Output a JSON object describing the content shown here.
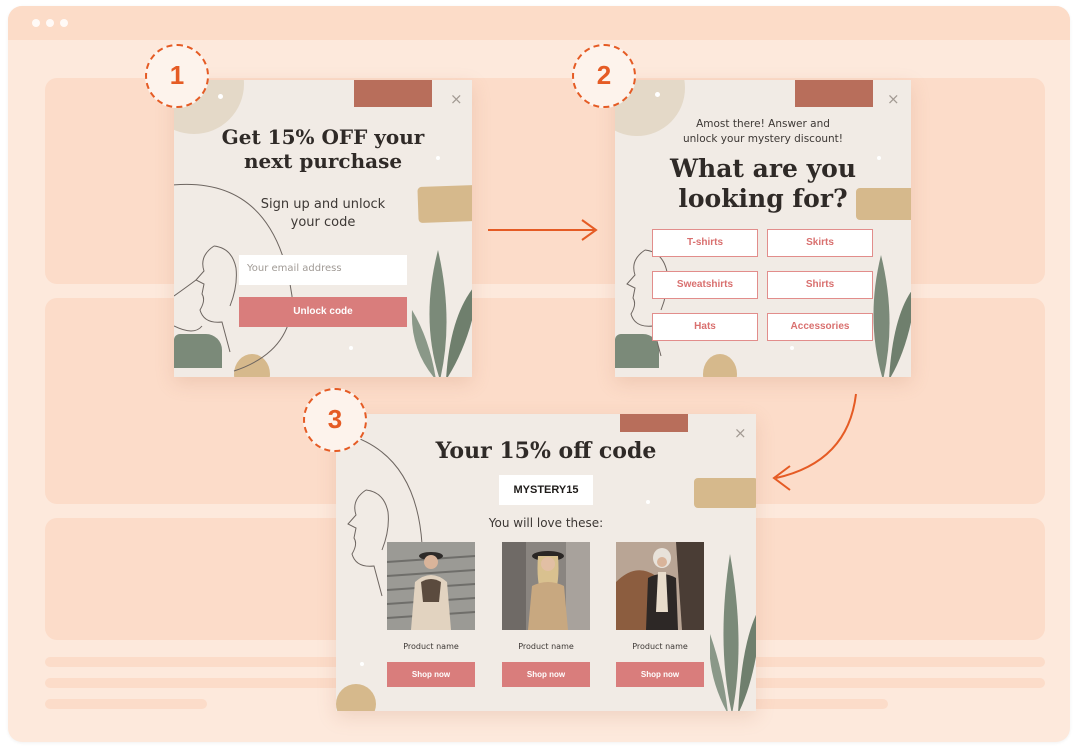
{
  "colors": {
    "accent": "#d97d7c",
    "badge": "#e55b24",
    "bg": "#fde9dc",
    "popup": "#f1ebe5"
  },
  "steps": [
    {
      "number": "1"
    },
    {
      "number": "2"
    },
    {
      "number": "3"
    }
  ],
  "popup1": {
    "title_line1": "Get 15% OFF your",
    "title_line2": "next purchase",
    "sub_line1": "Sign up and unlock",
    "sub_line2": "your code",
    "email_placeholder": "Your email address",
    "button": "Unlock code",
    "close": "×"
  },
  "popup2": {
    "sub_line1": "Amost there! Answer and",
    "sub_line2": "unlock your mystery discount!",
    "title_line1": "What are you",
    "title_line2": "looking for?",
    "options": [
      "T-shirts",
      "Skirts",
      "Sweatshirts",
      "Shirts",
      "Hats",
      "Accessories"
    ],
    "close": "×"
  },
  "popup3": {
    "title": "Your 15% off code",
    "code": "MYSTERY15",
    "sub": "You will love these:",
    "products": [
      {
        "name": "Product name",
        "button": "Shop now"
      },
      {
        "name": "Product name",
        "button": "Shop now"
      },
      {
        "name": "Product name",
        "button": "Shop now"
      }
    ],
    "close": "×"
  }
}
